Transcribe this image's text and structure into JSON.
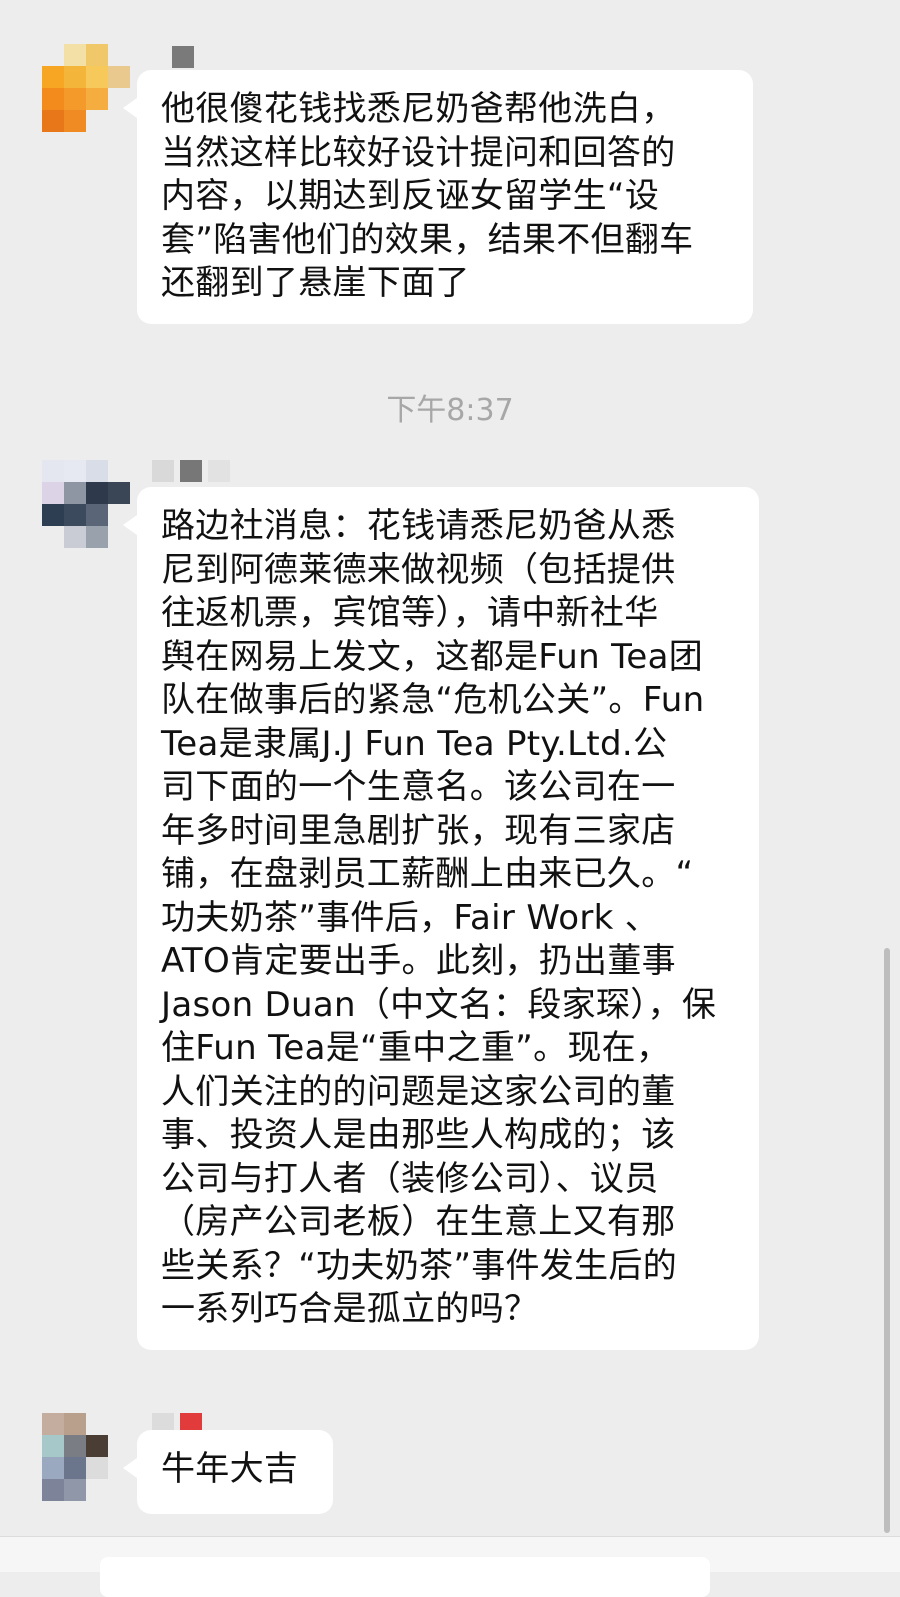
{
  "timestamp": "下午8:37",
  "messages": [
    {
      "lines": [
        "他很傻花钱找悉尼奶爸帮他洗白，",
        "当然这样比较好设计提问和回答的",
        "内容，以期达到反诬女留学生“设",
        "套”陷害他们的效果，结果不但翻车",
        "还翻到了悬崖下面了"
      ]
    },
    {
      "lines": [
        "路边社消息：花钱请悉尼奶爸从悉",
        "尼到阿德莱德来做视频（包括提供",
        "往返机票，宾馆等），请中新社华",
        "舆在网易上发文，这都是Fun Tea团",
        "队在做事后的紧急“危机公关”。Fun",
        "Tea是隶属J.J Fun Tea Pty.Ltd.公",
        "司下面的一个生意名。该公司在一",
        "年多时间里急剧扩张，现有三家店",
        "铺，在盘剥员工薪酬上由来已久。“",
        "功夫奶茶”事件后，Fair Work 、",
        "ATO肯定要出手。此刻，扔出董事",
        "Jason Duan（中文名：段家琛），保",
        "住Fun Tea是“重中之重”。现在，",
        "人们关注的的问题是这家公司的董",
        "事、投资人是由那些人构成的；该",
        "公司与打人者（装修公司）、议员",
        "（房产公司老板）在生意上又有那",
        "些关系？“功夫奶茶”事件发生后的",
        "一系列巧合是孤立的吗？"
      ]
    },
    {
      "lines": [
        "牛年大吉"
      ]
    }
  ],
  "avatars": [
    {
      "name": "avatar-1",
      "cells": [
        "#ededed",
        "#f3e0a6",
        "#f0c86a",
        "#ededed",
        "#f6a623",
        "#f4b63a",
        "#f7c95a",
        "#e9c98e",
        "#f28a1c",
        "#f39a2a",
        "#f6ad40",
        "#ededed",
        "#e8771a",
        "#f08a22",
        "#ededed",
        "#ededed"
      ]
    },
    {
      "name": "avatar-2",
      "cells": [
        "#e4e7f0",
        "#e6e9f2",
        "#d9dde8",
        "#ededed",
        "#dcd3e6",
        "#8e95a3",
        "#2e3a4c",
        "#3a4556",
        "#2d3d52",
        "#3b4a5d",
        "#5a6677",
        "#ededed",
        "#ededed",
        "#c9ccd4",
        "#99a1ad",
        "#ededed"
      ]
    },
    {
      "name": "avatar-3",
      "cells": [
        "#c4ad9e",
        "#b9a08c",
        "#ededed",
        "#ededed",
        "#a7c8c9",
        "#7a7d84",
        "#4a3d34",
        "#ededed",
        "#9aa8c0",
        "#6b758c",
        "#dcdcdc",
        "#ededed",
        "#7d8499",
        "#8f97a8",
        "#ededed",
        "#ededed"
      ]
    }
  ],
  "senders": [
    {
      "cells": [
        "#7a7a7a",
        "#ededed"
      ]
    },
    {
      "cells": [
        "#d9d9d9",
        "#777777",
        "#e2e2e2",
        "#ededed"
      ]
    },
    {
      "cells": [
        "#dcdcdc",
        "#e23b3b"
      ]
    }
  ]
}
